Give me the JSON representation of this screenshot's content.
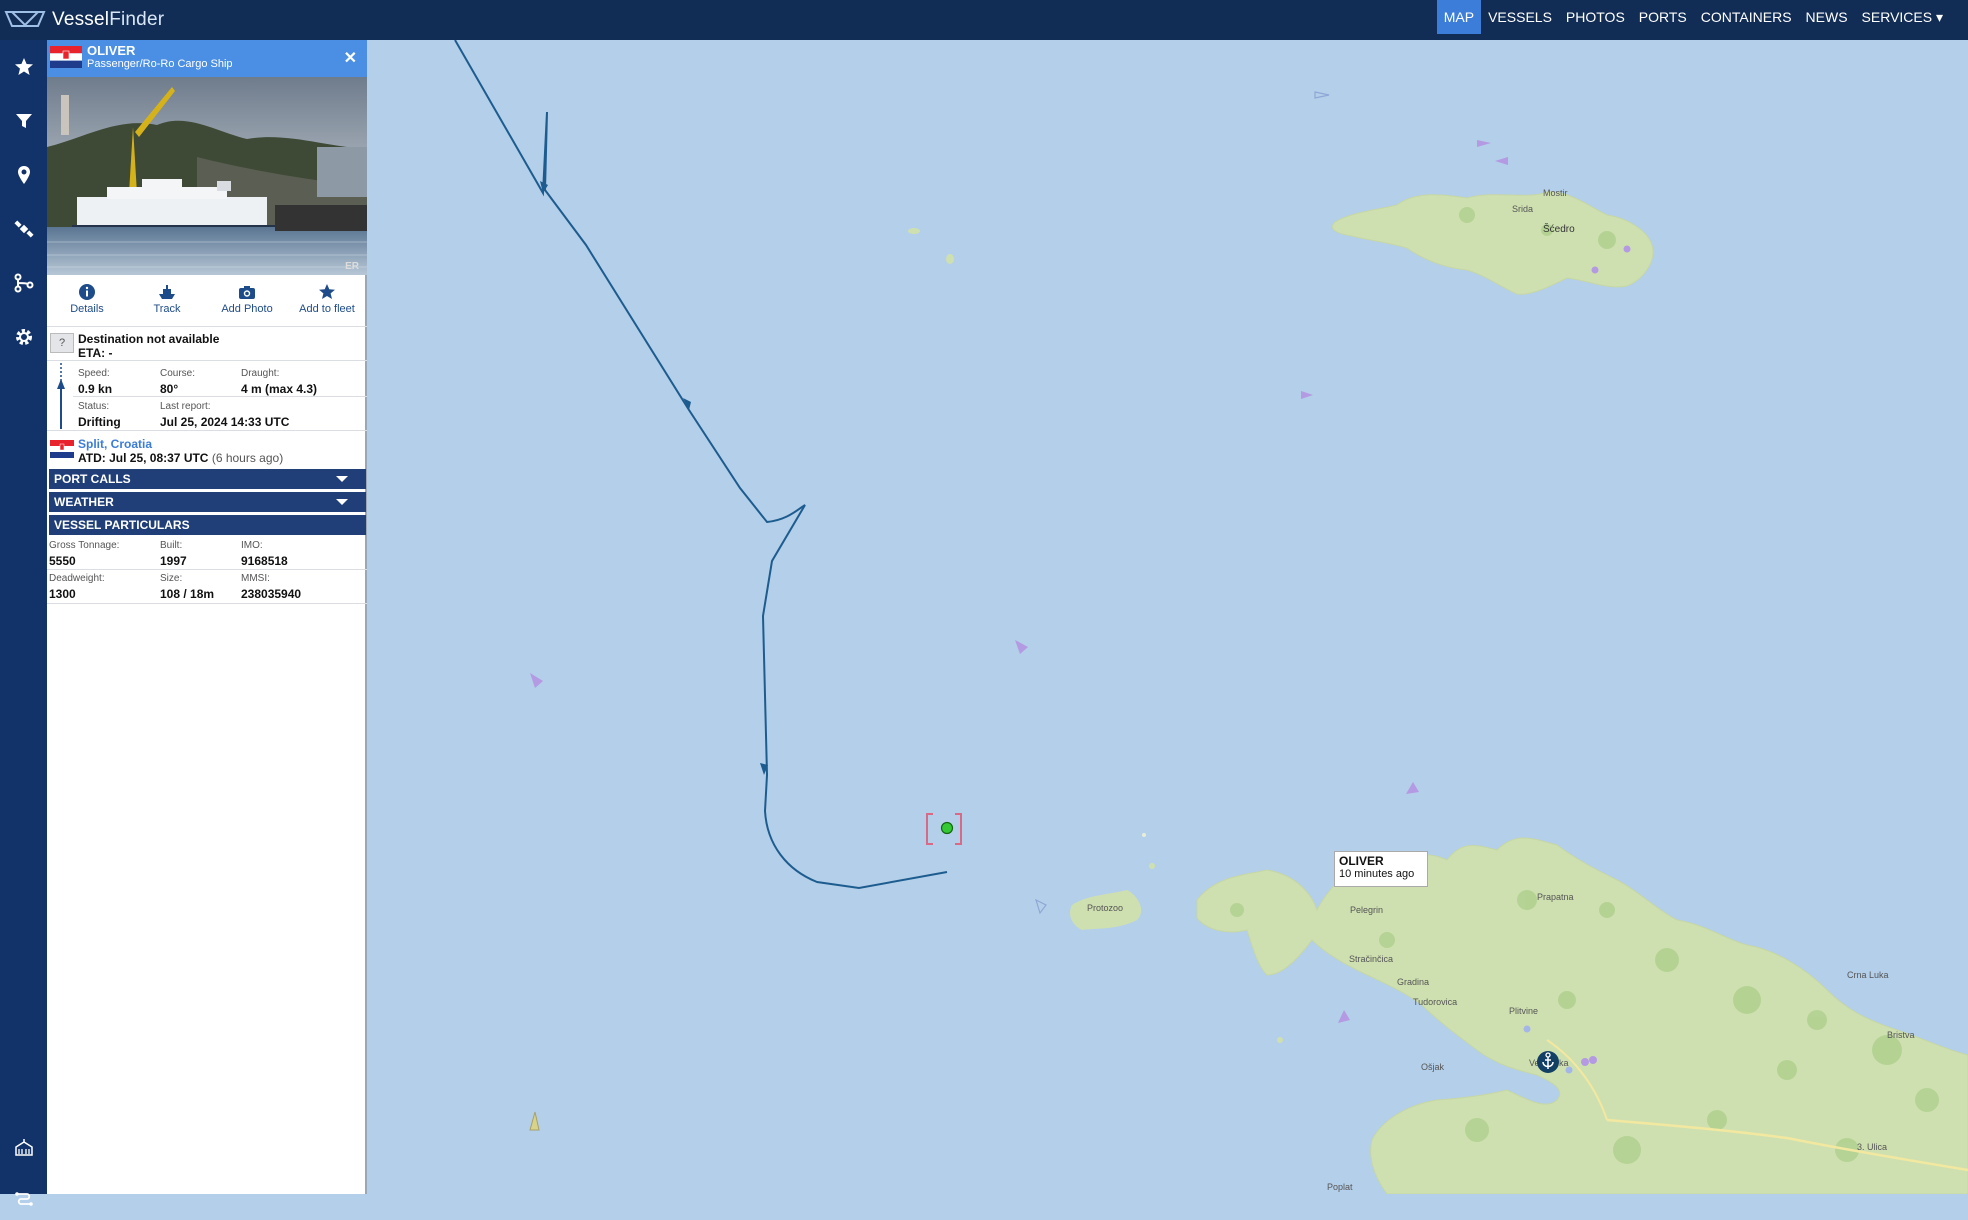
{
  "app": {
    "logo_text_a": "Vessel",
    "logo_text_b": "Finder"
  },
  "nav": {
    "items": [
      {
        "label": "MAP",
        "active": true
      },
      {
        "label": "VESSELS"
      },
      {
        "label": "PHOTOS"
      },
      {
        "label": "PORTS"
      },
      {
        "label": "CONTAINERS"
      },
      {
        "label": "NEWS"
      },
      {
        "label": "SERVICES ▾"
      }
    ]
  },
  "rail": {
    "icons": [
      "star-icon",
      "filter-icon",
      "map-pin-icon",
      "satellite-icon",
      "route-icon",
      "gear-icon",
      "container-icon",
      "route-planner-icon"
    ]
  },
  "vessel": {
    "name": "OLIVER",
    "type": "Passenger/Ro-Ro Cargo Ship",
    "photo_credit": "ER",
    "actions": {
      "details": "Details",
      "track": "Track",
      "add_photo": "Add Photo",
      "add_fleet": "Add to fleet"
    },
    "destination": "Destination not available",
    "eta": "ETA: -",
    "dest_q": "?",
    "speed_label": "Speed:",
    "speed": "0.9 kn",
    "course_label": "Course:",
    "course": "80°",
    "draught_label": "Draught:",
    "draught": "4 m (max 4.3)",
    "status_label": "Status:",
    "status": "Drifting",
    "last_report_label": "Last report:",
    "last_report": "Jul 25, 2024 14:33 UTC",
    "port": "Split, Croatia",
    "atd": "ATD: Jul 25, 08:37 UTC",
    "atd_ago": "(6 hours ago)"
  },
  "sections": {
    "port_calls": "PORT CALLS",
    "weather": "WEATHER",
    "particulars": "VESSEL PARTICULARS"
  },
  "particulars": {
    "gt_label": "Gross Tonnage:",
    "gt": "5550",
    "built_label": "Built:",
    "built": "1997",
    "imo_label": "IMO:",
    "imo": "9168518",
    "dwt_label": "Deadweight:",
    "dwt": "1300",
    "size_label": "Size:",
    "size": "108 / 18m",
    "mmsi_label": "MMSI:",
    "mmsi": "238035940"
  },
  "map": {
    "vessel_label": "OLIVER",
    "vessel_ago": "10 minutes ago",
    "places": {
      "mostir": "Mostir",
      "srida": "Srida",
      "scedro": "Šćedro",
      "protozoo": "Protozoo",
      "pelegrin": "Pelegrin",
      "prapatna": "Prapatna",
      "stracinica": "Stračinčica",
      "gradina": "Gradina",
      "tudorovica": "Tudorovica",
      "plitvine": "Plitvine",
      "osjak": "Ošjak",
      "vela_luka": "Vela Luka",
      "crna_luka": "Crna Luka",
      "bristva": "Bristva",
      "poplat": "Poplat",
      "ulica": "3. Ulica"
    }
  },
  "colors": {
    "topbar": "#122d55",
    "rail": "#12336a",
    "accent": "#3b7dd8",
    "track": "#1d5c8f",
    "sea": "#b4cfe9",
    "land": "#cfe0b0"
  }
}
